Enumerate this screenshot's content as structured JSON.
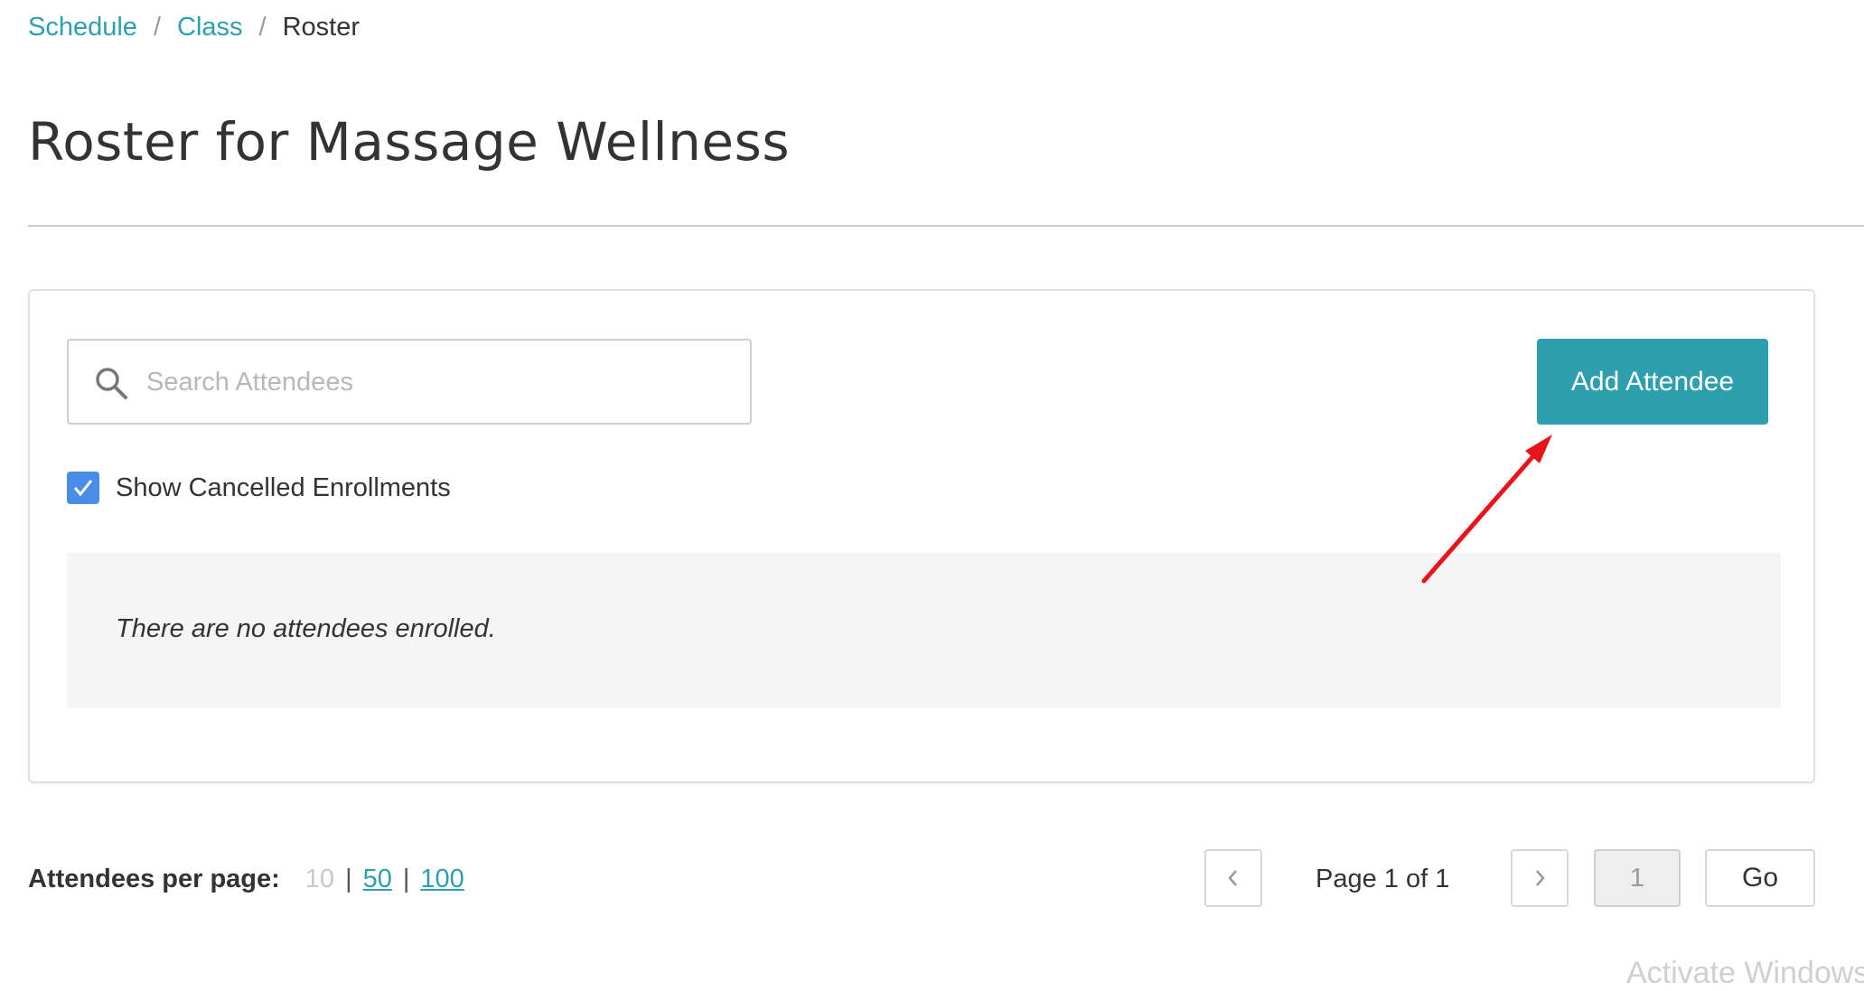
{
  "breadcrumb": {
    "items": [
      {
        "label": "Schedule"
      },
      {
        "label": "Class"
      },
      {
        "label": "Roster"
      }
    ],
    "separator": "/"
  },
  "page": {
    "title": "Roster for Massage Wellness"
  },
  "search": {
    "placeholder": "Search Attendees",
    "value": "",
    "icon": "search-icon"
  },
  "actions": {
    "add_attendee_label": "Add Attendee"
  },
  "filters": {
    "show_cancelled_label": "Show Cancelled Enrollments",
    "show_cancelled_checked": true
  },
  "roster": {
    "empty_message": "There are no attendees enrolled."
  },
  "pagination": {
    "per_page_label": "Attendees per page:",
    "per_page_options": [
      "10",
      "50",
      "100"
    ],
    "per_page_selected": "10",
    "status_text": "Page 1 of 1",
    "page_input_value": "1",
    "go_label": "Go"
  },
  "watermark": "Activate Windows",
  "colors": {
    "accent": "#2e9fae",
    "checkbox": "#4a8de6",
    "annotation_arrow": "#e8141b"
  }
}
